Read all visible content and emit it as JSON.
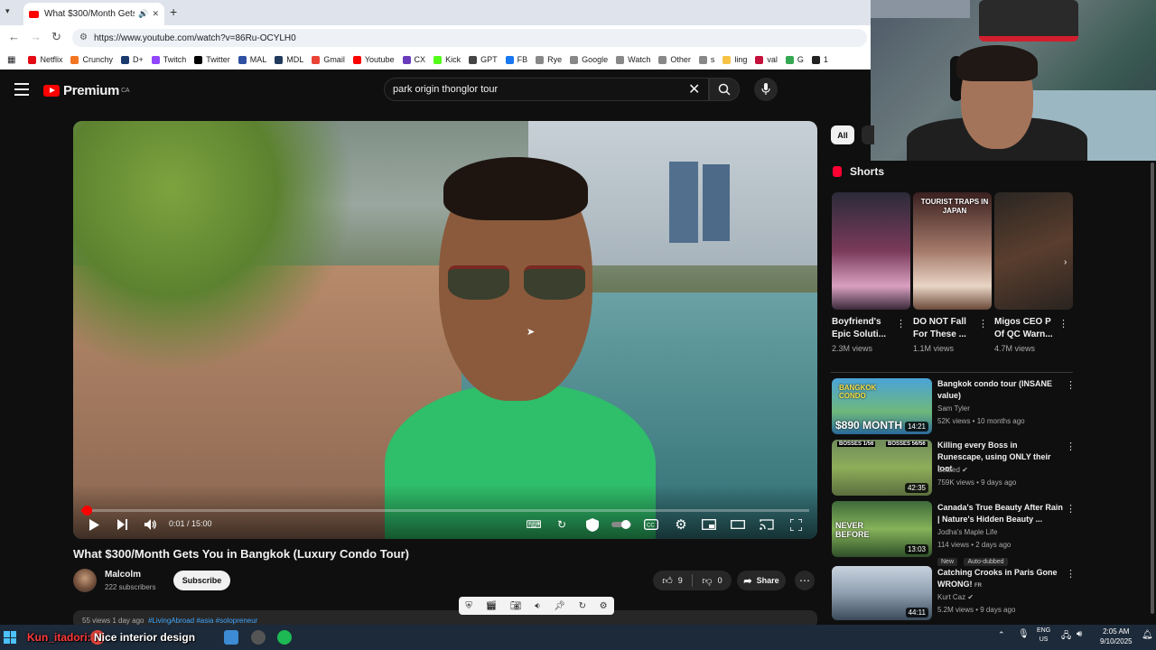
{
  "browser": {
    "tab_title": "What $300/Month Gets Yo",
    "new_tab": "+",
    "url": "https://www.youtube.com/watch?v=86Ru-OCYLH0",
    "bookmarks": [
      {
        "label": "Netflix",
        "color": "#e50914"
      },
      {
        "label": "Crunchy",
        "color": "#f47521"
      },
      {
        "label": "D+",
        "color": "#1a3b6e"
      },
      {
        "label": "Twitch",
        "color": "#9146ff"
      },
      {
        "label": "Twitter",
        "color": "#000000"
      },
      {
        "label": "MAL",
        "color": "#2e51a2"
      },
      {
        "label": "MDL",
        "color": "#1f3a5c"
      },
      {
        "label": "Gmail",
        "color": "#ea4335"
      },
      {
        "label": "Youtube",
        "color": "#ff0000"
      },
      {
        "label": "CX",
        "color": "#6a3cbc"
      },
      {
        "label": "Kick",
        "color": "#53fc18"
      },
      {
        "label": "GPT",
        "color": "#444444"
      },
      {
        "label": "FB",
        "color": "#1877f2"
      },
      {
        "label": "Rye",
        "color": "#888888"
      },
      {
        "label": "Google",
        "color": "#888888"
      },
      {
        "label": "Watch",
        "color": "#888888"
      },
      {
        "label": "Other",
        "color": "#888888"
      },
      {
        "label": "s",
        "color": "#888888"
      },
      {
        "label": "ling",
        "color": "#f6c344"
      },
      {
        "label": "val",
        "color": "#c4103a"
      },
      {
        "label": "G",
        "color": "#34a853"
      },
      {
        "label": "1",
        "color": "#222222"
      }
    ]
  },
  "youtube": {
    "logo_text": "Premium",
    "logo_region": "CA",
    "search_value": "park origin thonglor tour"
  },
  "player": {
    "time": "0:01 / 15:00",
    "progress_fraction": 0.008
  },
  "video": {
    "title": "What $300/Month Gets You in Bangkok (Luxury Condo Tour)",
    "channel": "Malcolm",
    "subscribers": "222 subscribers",
    "subscribe_label": "Subscribe",
    "likes": "9",
    "dislikes": "0",
    "share_label": "Share",
    "views_date": "55 views  1 day ago",
    "tags": "#LivingAbroad #asia #solopreneur"
  },
  "sidebar": {
    "chip_all": "All",
    "shorts_heading": "Shorts",
    "shorts": [
      {
        "title": "Boyfriend's Epic Soluti...",
        "views": "2.3M views",
        "thumb_text": ""
      },
      {
        "title": "DO NOT Fall For These ...",
        "views": "1.1M views",
        "thumb_text": "TOURIST TRAPS IN JAPAN"
      },
      {
        "title": "Migos CEO P Of QC Warn...",
        "views": "4.7M views",
        "thumb_text": ""
      }
    ],
    "videos": [
      {
        "title": "Bangkok condo tour (INSANE value)",
        "channel": "Sam Tyler",
        "meta": "52K views • 10 months ago",
        "duration": "14:21",
        "thumb_text": "$890 MONTH",
        "thumb_sub": "BANGKOK CONDO",
        "verified": false,
        "badges": []
      },
      {
        "title": "Killing every Boss in Runescape, using ONLY their loot",
        "channel": "Settled",
        "meta": "759K views • 9 days ago",
        "duration": "42:35",
        "thumb_text": "BOSSES 1/56",
        "thumb_sub": "BOSSES 56/56",
        "verified": true,
        "badges": []
      },
      {
        "title": "Canada's True Beauty After Rain | Nature's Hidden Beauty ...",
        "channel": "Jodha's Maple Life",
        "meta": "114 views • 2 days ago",
        "duration": "13:03",
        "thumb_text": "NEVER BEFORE",
        "thumb_sub": "",
        "verified": false,
        "badges": [
          "New",
          "Auto-dubbed"
        ]
      },
      {
        "title": "Catching Crooks in Paris Gone WRONG!",
        "title_suffix": "FR",
        "channel": "Kurt Caz",
        "meta": "5.2M views • 9 days ago",
        "duration": "44:11",
        "thumb_text": "",
        "thumb_sub": "",
        "verified": true,
        "badges": []
      }
    ]
  },
  "stream": {
    "caption_user": "Kun_itadori:",
    "caption_text": "Nice interior design"
  },
  "taskbar": {
    "lang_top": "ENG",
    "lang_bottom": "US",
    "time": "2:05 AM",
    "date": "9/10/2025"
  }
}
